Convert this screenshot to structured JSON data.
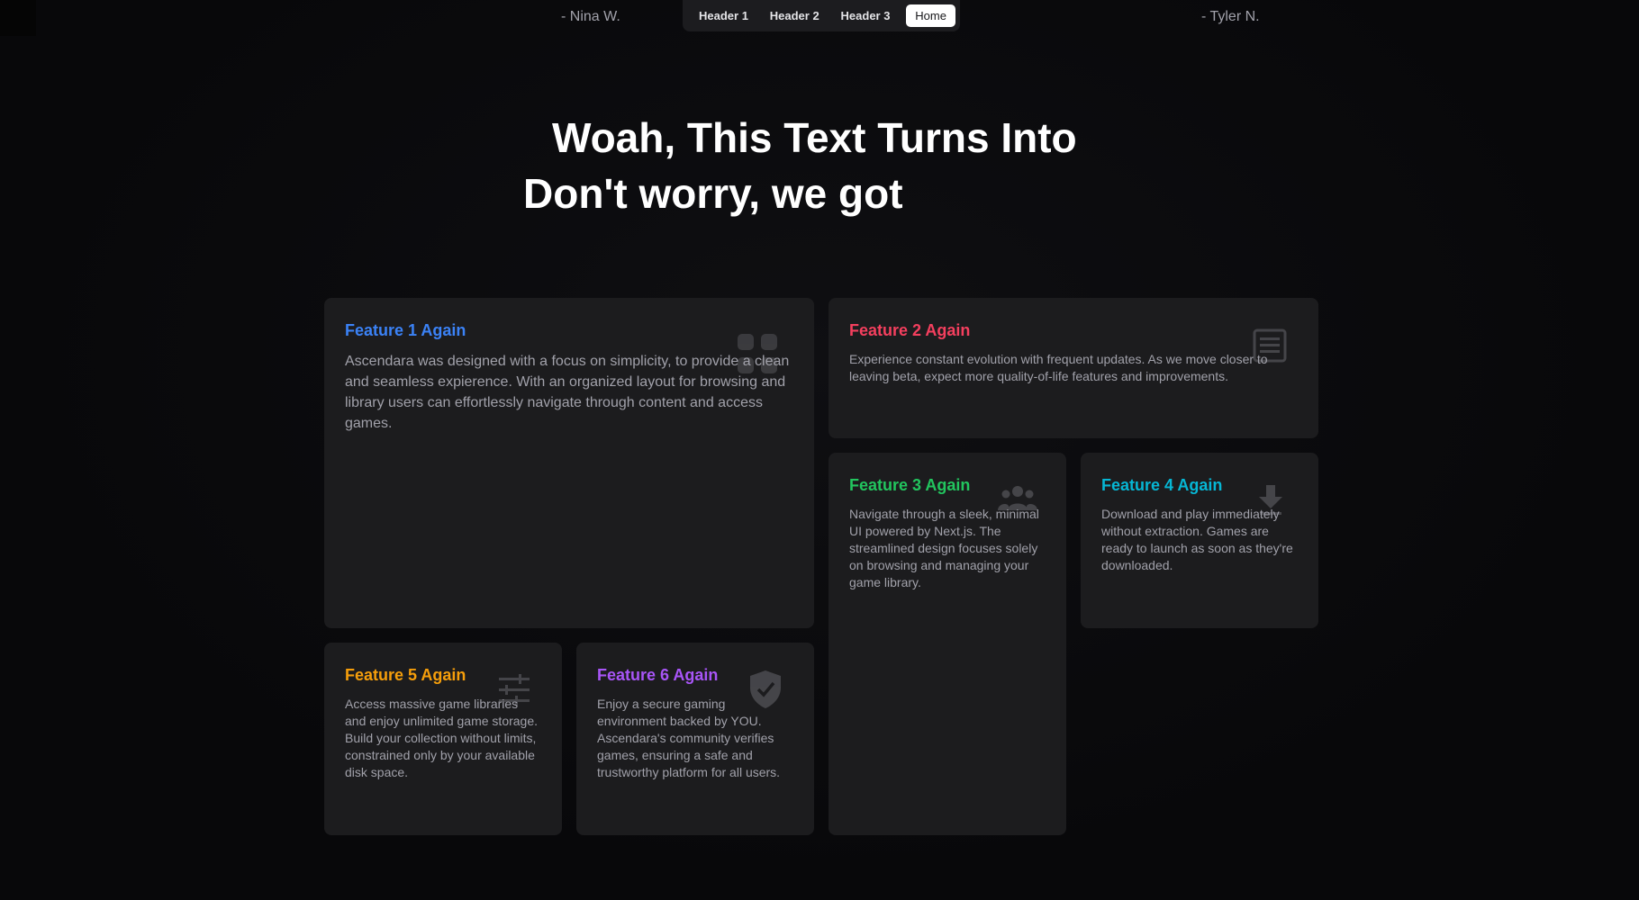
{
  "testimonials": {
    "left": "- Nina W.",
    "right": "- Tyler N."
  },
  "nav": {
    "items": [
      "Header 1",
      "Header 2",
      "Header 3",
      "Home"
    ],
    "active": "Home"
  },
  "hero": {
    "line1": "Woah, This Text Turns Into",
    "line2": "Don't worry, we got"
  },
  "features": [
    {
      "title": "Feature 1 Again",
      "body": "Ascendara was designed with a focus on simplicity, to provide a clean and seamless expierence. With an organized layout for browsing and library users can effortlessly navigate through content and access games.",
      "icon": "grid-icon",
      "color": "#3b82f6"
    },
    {
      "title": "Feature 2 Again",
      "body": "Experience constant evolution with frequent updates. As we move closer to leaving beta, expect more quality-of-life features and improvements.",
      "icon": "list-document-icon",
      "color": "#f43f5e"
    },
    {
      "title": "Feature 3 Again",
      "body": "Navigate through a sleek, minimal UI powered by Next.js. The streamlined design focuses solely on browsing and managing your game library.",
      "icon": "people-icon",
      "color": "#22c55e"
    },
    {
      "title": "Feature 4 Again",
      "body": "Download and play immediately without extraction. Games are ready to launch as soon as they're downloaded.",
      "icon": "download-icon",
      "color": "#06b6d4"
    },
    {
      "title": "Feature 5 Again",
      "body": "Access massive game libraries and enjoy unlimited game storage. Build your collection without limits, constrained only by your available disk space.",
      "icon": "sliders-icon",
      "color": "#f59e0b"
    },
    {
      "title": "Feature 6 Again",
      "body": "Enjoy a secure gaming environment backed by YOU. Ascendara's community verifies games, ensuring a safe and trustworthy platform for all users.",
      "icon": "shield-check-icon",
      "color": "#a855f7"
    }
  ]
}
